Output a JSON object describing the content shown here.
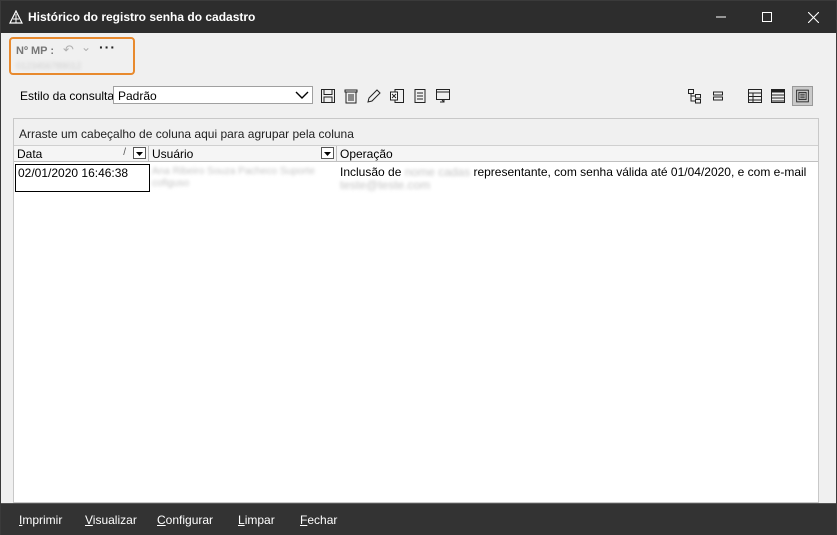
{
  "window": {
    "title": "Histórico do registro senha do cadastro"
  },
  "mp": {
    "label": "Nº MP :",
    "undo_glyph": "↶",
    "redo_glyph": "⌄",
    "more_glyph": "···",
    "value": "0123456789012"
  },
  "query_style": {
    "label": "Estilo da consulta",
    "selected": "Padrão"
  },
  "grid": {
    "group_hint": "Arraste um cabeçalho de coluna aqui para agrupar pela coluna",
    "columns": [
      {
        "label": "Data",
        "sort_glyph": "/"
      },
      {
        "label": "Usuário"
      },
      {
        "label": "Operação"
      }
    ],
    "rows": [
      {
        "date": "02/01/2020 16:46:38",
        "user": "Ana Ribeiro Souza Pacheco Suporte cofiguso",
        "op_prefix": "Inclusão de",
        "op_redacted": "nome cadas",
        "op_suffix": "representante, com senha válida até 01/04/2020, e com e-mail",
        "op_email": "teste@teste.com"
      }
    ]
  },
  "footer": {
    "print": {
      "first": "I",
      "rest": "mprimir"
    },
    "view": {
      "first": "V",
      "rest": "isualizar"
    },
    "configure": {
      "first": "C",
      "rest": "onfigurar"
    },
    "clear": {
      "first": "L",
      "rest": "impar"
    },
    "close": {
      "first": "F",
      "rest": "echar"
    }
  },
  "colors": {
    "titlebar": "#2d2d2d",
    "highlight": "#e88a2e",
    "footer": "#333333"
  }
}
